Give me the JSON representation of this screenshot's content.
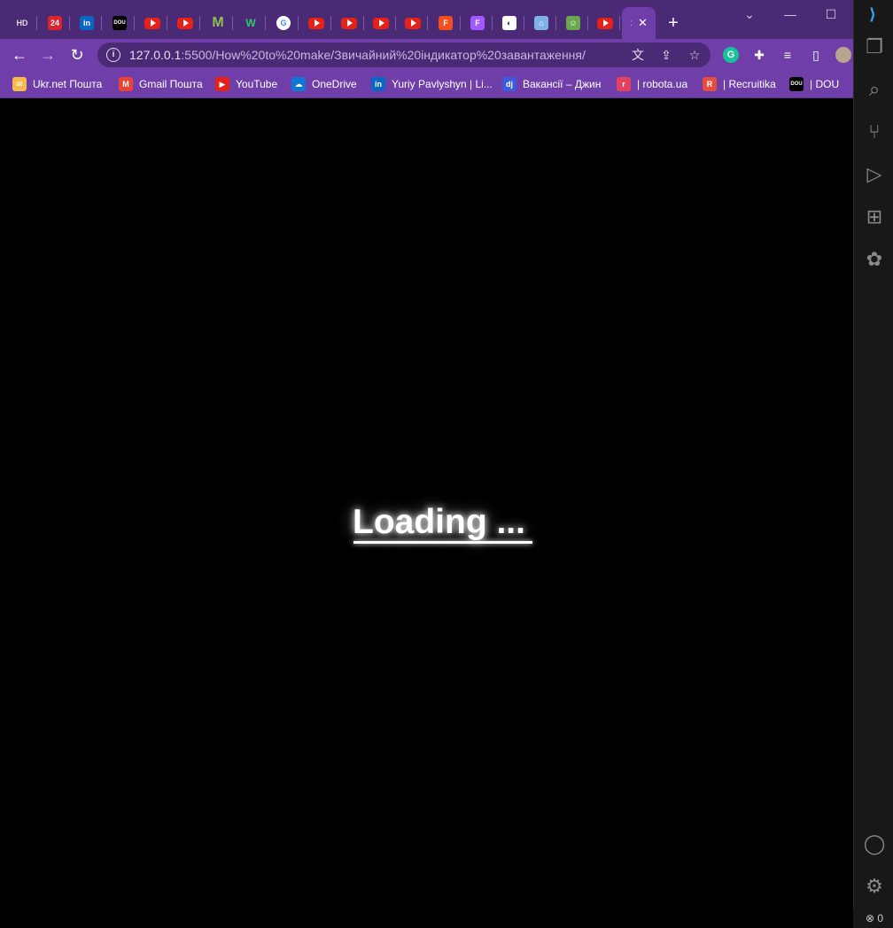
{
  "tabs": [
    {
      "icon": "hd-icon",
      "text": "HD",
      "bg": "#4a2a74"
    },
    {
      "icon": "24-icon",
      "text": "24",
      "bg": "#d9232e"
    },
    {
      "icon": "linkedin-icon",
      "text": "in",
      "bg": "#0a66c2"
    },
    {
      "icon": "dou-icon",
      "text": "DOU",
      "bg": "#000000"
    },
    {
      "icon": "youtube-icon",
      "text": "",
      "bg": "yt"
    },
    {
      "icon": "youtube-icon",
      "text": "",
      "bg": "yt"
    },
    {
      "icon": "m-icon",
      "text": "M",
      "bg": "#7ac142"
    },
    {
      "icon": "w-icon",
      "text": "W",
      "bg": "#1a8c4e"
    },
    {
      "icon": "google-icon",
      "text": "G",
      "bg": "#ffffff"
    },
    {
      "icon": "youtube-icon",
      "text": "",
      "bg": "yt"
    },
    {
      "icon": "youtube-icon",
      "text": "",
      "bg": "yt"
    },
    {
      "icon": "youtube-icon",
      "text": "",
      "bg": "yt"
    },
    {
      "icon": "youtube-icon",
      "text": "",
      "bg": "yt"
    },
    {
      "icon": "figma-icon",
      "text": "F",
      "bg": "#f24e1e"
    },
    {
      "icon": "figma-icon",
      "text": "F",
      "bg": "#a259ff"
    },
    {
      "icon": "globe-icon",
      "text": "◐",
      "bg": "#ffffff"
    },
    {
      "icon": "temple-icon",
      "text": "⌂",
      "bg": "#7fb2e6"
    },
    {
      "icon": "person-icon",
      "text": "☺",
      "bg": "#6aa84f"
    },
    {
      "icon": "youtube-icon",
      "text": "",
      "bg": "yt"
    }
  ],
  "active_tab_close": "✕",
  "active_tab_fav": ":",
  "new_tab": "+",
  "window_controls": {
    "minimize": "—",
    "maximize": "☐",
    "chevron": "⌄"
  },
  "nav": {
    "back": "←",
    "forward": "→",
    "reload": "↻"
  },
  "url": {
    "host": "127.0.0.1",
    "rest": ":5500/How%20to%20make/Звичайний%20індикатор%20завантаження/"
  },
  "bookmarks": [
    {
      "label": "Ukr.net Пошта",
      "icon": "ukrnet-icon",
      "ico_text": "✉",
      "ico_bg": "#f6b94b"
    },
    {
      "label": "Gmail Пошта",
      "icon": "gmail-icon",
      "ico_text": "M",
      "ico_bg": "#ea4335"
    },
    {
      "label": "YouTube",
      "icon": "youtube-icon",
      "ico_text": "▶",
      "ico_bg": "#e62117"
    },
    {
      "label": "OneDrive",
      "icon": "onedrive-icon",
      "ico_text": "☁",
      "ico_bg": "#0f78d4"
    },
    {
      "label": "Yuriy Pavlyshyn | Li...",
      "icon": "linkedin-icon",
      "ico_text": "in",
      "ico_bg": "#0a66c2"
    },
    {
      "label": "Вакансії – Джин",
      "icon": "djinni-icon",
      "ico_text": "dj",
      "ico_bg": "#3b5bdb"
    },
    {
      "label": "| robota.ua",
      "icon": "robota-icon",
      "ico_text": "r",
      "ico_bg": "#e4405f"
    },
    {
      "label": "| Recruitika",
      "icon": "recruitika-icon",
      "ico_text": "R",
      "ico_bg": "#e74c3c"
    },
    {
      "label": "| DOU",
      "icon": "dou-icon",
      "ico_text": "DOU",
      "ico_bg": "#000000"
    }
  ],
  "page": {
    "loading_text": "Loading ..."
  },
  "status": {
    "errors": "⊗ 0"
  }
}
